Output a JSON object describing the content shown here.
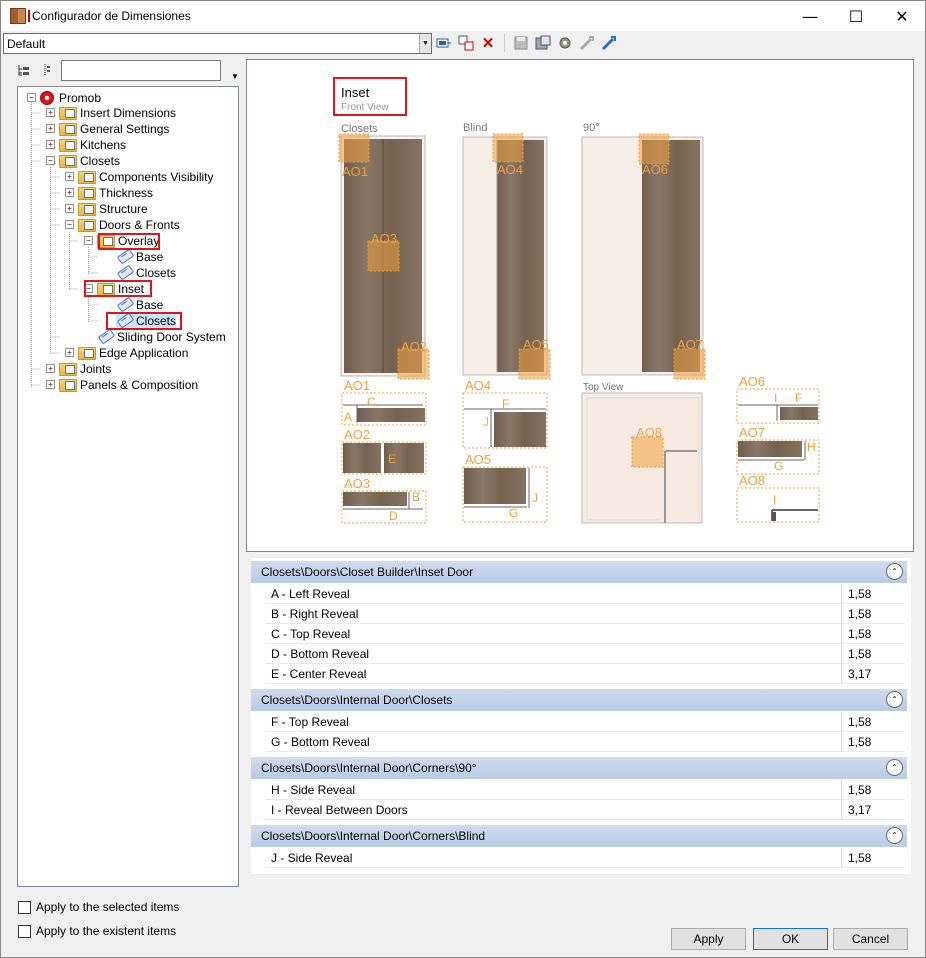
{
  "window": {
    "title": "Configurador de Dimensiones",
    "controls": {
      "minimize": "—",
      "maximize": "☐",
      "close": "✕"
    }
  },
  "toolbar": {
    "preset_value": "Default",
    "icons": [
      "apply-icon",
      "copy-icon",
      "delete-icon",
      "save-icon",
      "save-as-icon",
      "settings-icon",
      "import-icon",
      "export-icon"
    ]
  },
  "tree": {
    "filter_value": "",
    "items": [
      {
        "label": "Promob"
      },
      {
        "label": "Insert Dimensions"
      },
      {
        "label": "General Settings"
      },
      {
        "label": "Kitchens"
      },
      {
        "label": "Closets"
      },
      {
        "label": "Components Visibility"
      },
      {
        "label": "Thickness"
      },
      {
        "label": "Structure"
      },
      {
        "label": "Doors & Fronts"
      },
      {
        "label": "Overlay"
      },
      {
        "label": "Base"
      },
      {
        "label": "Closets"
      },
      {
        "label": "Inset"
      },
      {
        "label": "Base"
      },
      {
        "label": "Closets"
      },
      {
        "label": "Sliding Door System"
      },
      {
        "label": "Edge Application"
      },
      {
        "label": "Joints"
      },
      {
        "label": "Panels & Composition"
      }
    ]
  },
  "options": {
    "apply_selected": "Apply to the selected items",
    "apply_existent": "Apply to the existent items"
  },
  "preview": {
    "title": "Inset",
    "subtitle": "Front View",
    "col_closets": "Closets",
    "col_blind": "Blind",
    "col_90": "90°",
    "top_view": "Top View",
    "codes": {
      "AO1": "AO1",
      "AO2": "AO2",
      "AO3": "AO3",
      "AO4": "AO4",
      "AO5": "AO5",
      "AO6": "AO6",
      "AO7": "AO7",
      "AO8": "AO8"
    },
    "letters": {
      "A": "A",
      "B": "B",
      "C": "C",
      "D": "D",
      "E": "E",
      "F": "F",
      "G": "G",
      "H": "H",
      "I": "I",
      "J": "J"
    }
  },
  "groups": [
    {
      "title": "Closets\\Doors\\Closet Builder\\Inset Door",
      "rows": [
        {
          "label": "A - Left Reveal",
          "value": "1,58"
        },
        {
          "label": "B - Right Reveal",
          "value": "1,58"
        },
        {
          "label": "C - Top Reveal",
          "value": "1,58"
        },
        {
          "label": "D - Bottom Reveal",
          "value": "1,58"
        },
        {
          "label": "E - Center Reveal",
          "value": "3,17"
        }
      ]
    },
    {
      "title": "Closets\\Doors\\Internal Door\\Closets",
      "rows": [
        {
          "label": "F - Top Reveal",
          "value": "1,58"
        },
        {
          "label": "G - Bottom Reveal",
          "value": "1,58"
        }
      ]
    },
    {
      "title": "Closets\\Doors\\Internal Door\\Corners\\90°",
      "rows": [
        {
          "label": "H - Side Reveal",
          "value": "1,58"
        },
        {
          "label": "I - Reveal Between Doors",
          "value": "3,17"
        }
      ]
    },
    {
      "title": "Closets\\Doors\\Internal Door\\Corners\\Blind",
      "rows": [
        {
          "label": "J - Side Reveal",
          "value": "1,58"
        }
      ]
    }
  ],
  "buttons": {
    "apply": "Apply",
    "ok": "OK",
    "cancel": "Cancel"
  },
  "colors": {
    "accent_orange": "#f0a040",
    "highlight_red": "#e3141c",
    "group_header": "#c4d4ea",
    "wood": "#7c6a58"
  }
}
